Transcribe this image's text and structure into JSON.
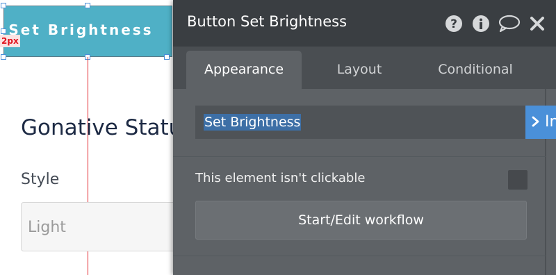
{
  "canvas": {
    "button_label": "Set Brightness",
    "size_badge": "2px",
    "heading": "Gonative Status",
    "style_label": "Style",
    "style_value": "Light"
  },
  "panel": {
    "title": "Button Set Brightness",
    "header_icons": [
      "help-icon",
      "info-icon",
      "comment-icon",
      "close-icon"
    ],
    "tabs": [
      {
        "label": "Appearance",
        "active": true
      },
      {
        "label": "Layout",
        "active": false
      },
      {
        "label": "Conditional",
        "active": false
      }
    ],
    "element_name_value": "Set Brightness",
    "insert_button_label": "In",
    "not_clickable_label": "This element isn't clickable",
    "not_clickable_checked": false,
    "workflow_button_label": "Start/Edit workflow"
  },
  "colors": {
    "canvas_button_bg": "#4fb0c6",
    "panel_bg": "#5e6266",
    "panel_header_bg": "#3a3e42",
    "accent_blue": "#4a90d9",
    "guide_red": "#e2262d"
  }
}
